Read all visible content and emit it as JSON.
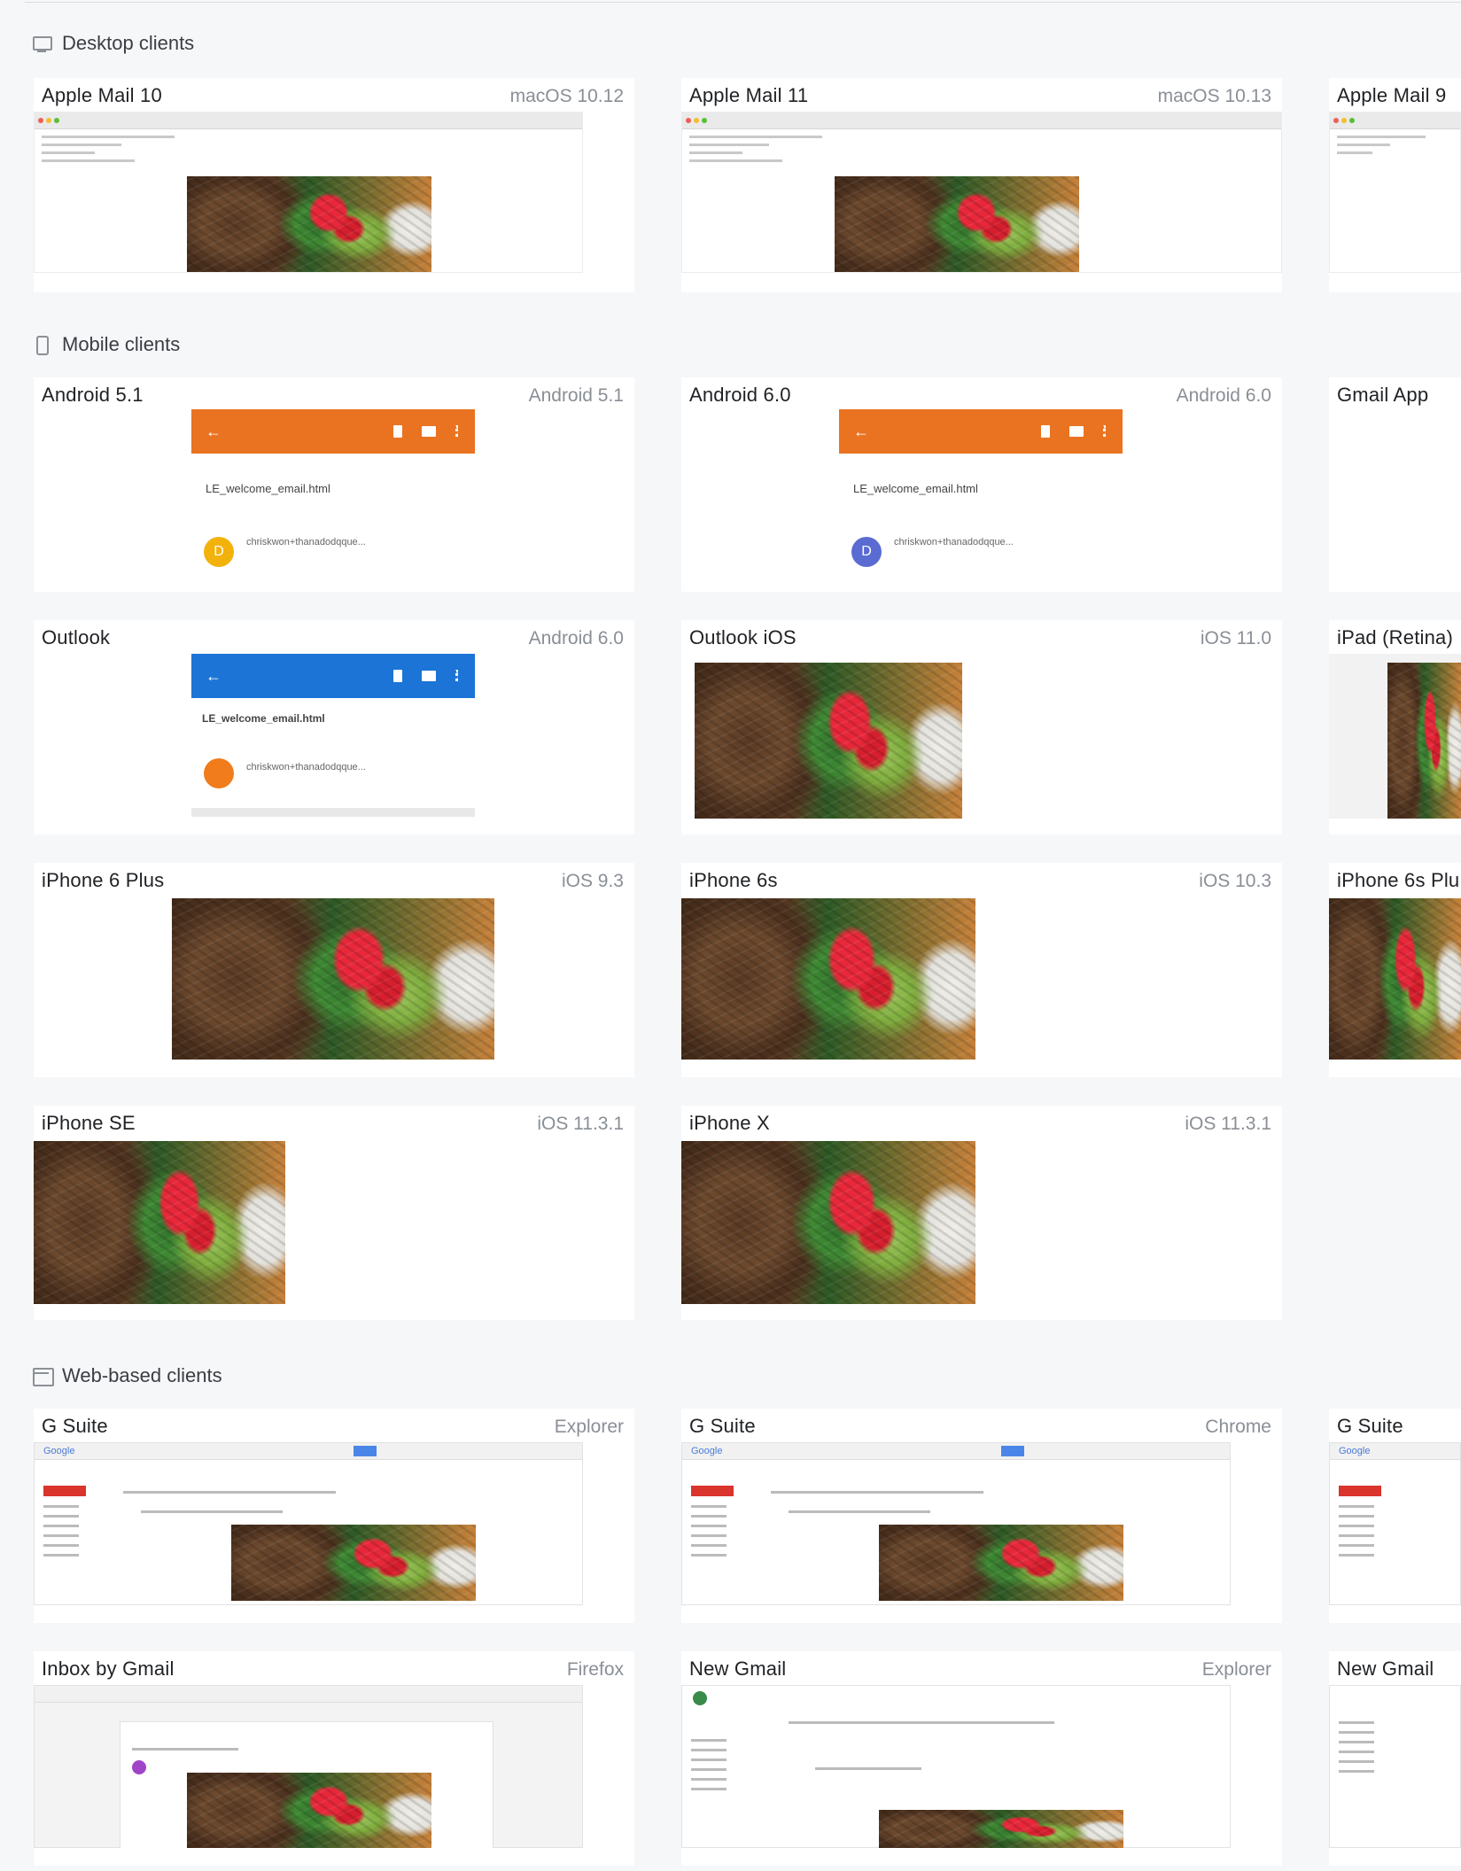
{
  "sections": {
    "desktop": {
      "title": "Desktop clients",
      "icon": "monitor-icon"
    },
    "mobile": {
      "title": "Mobile clients",
      "icon": "phone-icon"
    },
    "web": {
      "title": "Web-based clients",
      "icon": "browser-window-icon"
    }
  },
  "desktop_cards": [
    {
      "title": "Apple Mail 10",
      "platform": "macOS 10.12"
    },
    {
      "title": "Apple Mail 11",
      "platform": "macOS 10.13"
    },
    {
      "title": "Apple Mail 9",
      "platform": ""
    }
  ],
  "mobile_cards": [
    {
      "title": "Android 5.1",
      "platform": "Android 5.1",
      "subject": "LE_welcome_email.html",
      "sender": "chriskwon+thanadodqque..."
    },
    {
      "title": "Android 6.0",
      "platform": "Android 6.0",
      "subject": "LE_welcome_email.html",
      "sender": "chriskwon+thanadodqque..."
    },
    {
      "title": "Gmail App",
      "platform": ""
    },
    {
      "title": "Outlook",
      "platform": "Android 6.0",
      "subject": "LE_welcome_email.html",
      "sender": "chriskwon+thanadodqque..."
    },
    {
      "title": "Outlook iOS",
      "platform": "iOS 11.0"
    },
    {
      "title": "iPad (Retina)",
      "platform": ""
    },
    {
      "title": "iPhone 6 Plus",
      "platform": "iOS 9.3"
    },
    {
      "title": "iPhone 6s",
      "platform": "iOS 10.3"
    },
    {
      "title": "iPhone 6s Plu",
      "platform": ""
    },
    {
      "title": "iPhone SE",
      "platform": "iOS 11.3.1"
    },
    {
      "title": "iPhone X",
      "platform": "iOS 11.3.1"
    }
  ],
  "web_cards": [
    {
      "title": "G Suite",
      "platform": "Explorer"
    },
    {
      "title": "G Suite",
      "platform": "Chrome"
    },
    {
      "title": "G Suite",
      "platform": ""
    },
    {
      "title": "Inbox by Gmail",
      "platform": "Firefox"
    },
    {
      "title": "New Gmail",
      "platform": "Explorer"
    },
    {
      "title": "New Gmail",
      "platform": ""
    }
  ],
  "mock": {
    "google_logo": "Google",
    "avatar_letter": "D",
    "avatar_letter_2": "D"
  },
  "colors": {
    "android_orange": "#e97320",
    "outlook_blue": "#1c74d6",
    "avatar_yellow": "#f2b20b",
    "avatar_blue": "#5a6bd2",
    "avatar_orange": "#f07c1c"
  }
}
